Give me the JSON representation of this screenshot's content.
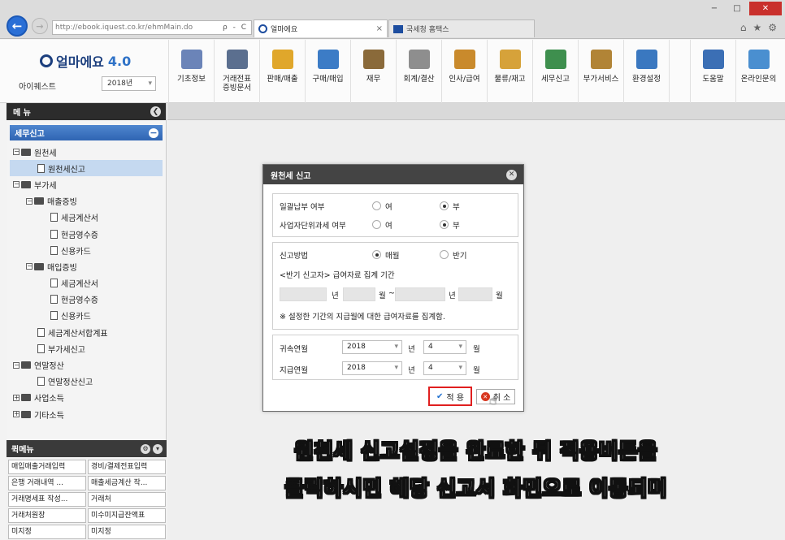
{
  "browser": {
    "url": "http://ebook.iquest.co.kr/ehmMain.do",
    "address_tools": "ρ - C",
    "tabs": [
      {
        "label": "얼마에요",
        "close": "×"
      },
      {
        "label": "국세청 홈택스"
      }
    ],
    "window_controls": [
      "−",
      "□",
      "✕"
    ],
    "toolbar_icons": [
      "⌂",
      "★",
      "⚙"
    ]
  },
  "app": {
    "logo_text": "얼마에요",
    "logo_version": "4.0",
    "company": "아이퀘스트",
    "year_select": "2018년"
  },
  "main_menu": [
    {
      "label": "기초정보",
      "color": "#6b84b8"
    },
    {
      "label": "거래전표\n증빙문서",
      "color": "#5b6f8f"
    },
    {
      "label": "판매/매출",
      "color": "#e0a72b"
    },
    {
      "label": "구매/매입",
      "color": "#3c7cc6"
    },
    {
      "label": "재무",
      "color": "#8a6a3a"
    },
    {
      "label": "회계/결산",
      "color": "#8e8e8e"
    },
    {
      "label": "인사/급여",
      "color": "#c98a2c"
    },
    {
      "label": "물류/재고",
      "color": "#d6a23a"
    },
    {
      "label": "세무신고",
      "color": "#3e8f4e"
    },
    {
      "label": "부가서비스",
      "color": "#b18436"
    },
    {
      "label": "환경설정",
      "color": "#3a78c0"
    },
    {
      "label": "도움말",
      "color": "#3b6fb5"
    },
    {
      "label": "온라인문의",
      "color": "#4a8fd0"
    }
  ],
  "sidebar": {
    "title": "메 뉴",
    "section": "세무신고",
    "tree": [
      {
        "label": "원천세",
        "level": 0,
        "type": "folder",
        "exp": "−"
      },
      {
        "label": "원천세신고",
        "level": 1,
        "type": "doc",
        "selected": true
      },
      {
        "label": "부가세",
        "level": 0,
        "type": "folder",
        "exp": "−"
      },
      {
        "label": "매출증빙",
        "level": 1,
        "type": "folder",
        "exp": "−"
      },
      {
        "label": "세금계산서",
        "level": 2,
        "type": "doc"
      },
      {
        "label": "현금영수증",
        "level": 2,
        "type": "doc"
      },
      {
        "label": "신용카드",
        "level": 2,
        "type": "doc"
      },
      {
        "label": "매입증빙",
        "level": 1,
        "type": "folder",
        "exp": "−"
      },
      {
        "label": "세금계산서",
        "level": 2,
        "type": "doc"
      },
      {
        "label": "현금영수증",
        "level": 2,
        "type": "doc"
      },
      {
        "label": "신용카드",
        "level": 2,
        "type": "doc"
      },
      {
        "label": "세금계산서합계표",
        "level": 1,
        "type": "doc"
      },
      {
        "label": "부가세신고",
        "level": 1,
        "type": "doc"
      },
      {
        "label": "연말정산",
        "level": 0,
        "type": "folder",
        "exp": "−"
      },
      {
        "label": "연말정산신고",
        "level": 1,
        "type": "doc"
      },
      {
        "label": "사업소득",
        "level": 0,
        "type": "folder",
        "exp": "+"
      },
      {
        "label": "기타소득",
        "level": 0,
        "type": "folder",
        "exp": "+"
      }
    ]
  },
  "quick_menu": {
    "title": "퀵메뉴",
    "items": [
      "매입매출거래입력",
      "경비/결제전표입력",
      "은행 거래내역 ...",
      "매출세금계산 작...",
      "거래명세표 작성...",
      "거래처",
      "거래처원장",
      "미수미지급잔액표",
      "미지정",
      "미지정"
    ]
  },
  "dialog": {
    "title": "원천세 신고",
    "close": "✕",
    "row1_label": "일괄납부 여부",
    "row1_opt1": "여",
    "row1_opt2": "부",
    "row2_label": "사업자단위과세 여부",
    "row2_opt1": "여",
    "row2_opt2": "부",
    "method_label": "신고방법",
    "method_opt1": "매월",
    "method_opt2": "반기",
    "half_note": "<반기 신고자> 급여자료 집계 기간",
    "year_unit": "년",
    "month_unit": "월",
    "tilde": "~",
    "summary_note": "※ 설정한 기간의 지급월에 대한 급여자료를 집계함.",
    "belong_label": "귀속연월",
    "belong_year": "2018",
    "belong_month": "4",
    "pay_label": "지급연월",
    "pay_year": "2018",
    "pay_month": "4",
    "apply": "적 용",
    "cancel": "취 소"
  },
  "subtitles": {
    "line1": "원천세 신고설정을 완료한 뒤 적용버튼을",
    "line2": "클릭하시면 해당 신고서 화면으로 이동되며"
  },
  "colors": {
    "accent": "#2f65b3",
    "highlight": "#e01f1f"
  }
}
